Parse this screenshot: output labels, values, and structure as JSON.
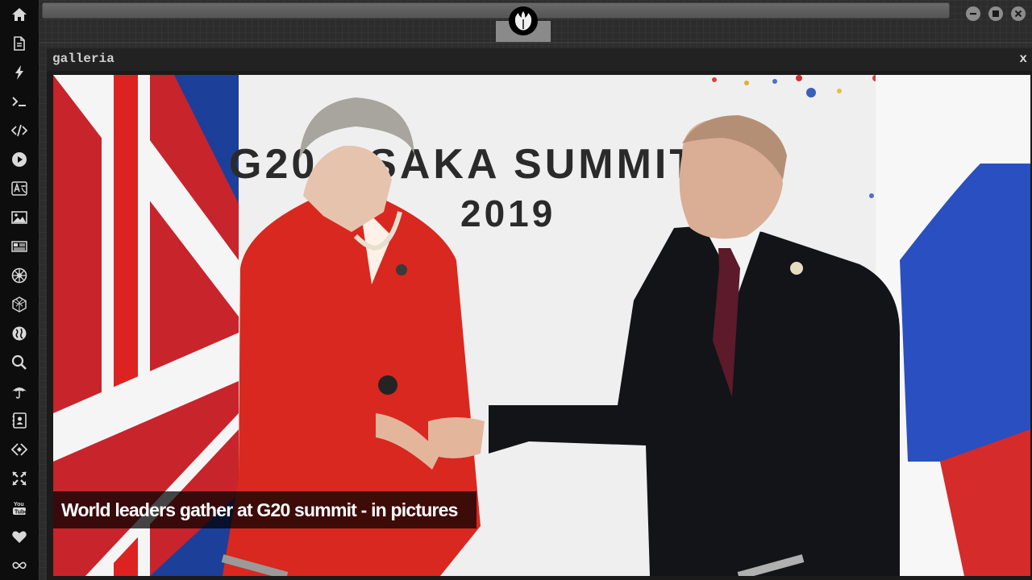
{
  "sidebar": {
    "items": [
      {
        "icon": "home-icon"
      },
      {
        "icon": "document-icon"
      },
      {
        "icon": "lightning-icon"
      },
      {
        "icon": "terminal-icon"
      },
      {
        "icon": "code-icon"
      },
      {
        "icon": "play-icon"
      },
      {
        "icon": "translate-icon"
      },
      {
        "icon": "image-icon"
      },
      {
        "icon": "newspaper-icon"
      },
      {
        "icon": "empire-icon"
      },
      {
        "icon": "cube-icon"
      },
      {
        "icon": "globe-icon"
      },
      {
        "icon": "search-icon"
      },
      {
        "icon": "umbrella-icon"
      },
      {
        "icon": "contacts-icon"
      },
      {
        "icon": "link-code-icon"
      },
      {
        "icon": "expand-icon"
      },
      {
        "icon": "youtube-icon"
      },
      {
        "icon": "heart-icon"
      },
      {
        "icon": "infinity-icon"
      }
    ]
  },
  "topbar": {
    "logo_icon": "rebel-alliance-icon",
    "buttons": [
      "minimize-icon",
      "maximize-icon",
      "close-icon"
    ]
  },
  "window": {
    "title": "galleria",
    "close_label": "x"
  },
  "gallery": {
    "banner_line1": "G20 OSAKA SUMMIT",
    "banner_line2": "2019",
    "caption": "World leaders gather at G20 summit - in pictures"
  },
  "colors": {
    "sidebar_bg": "#0d0d0d",
    "icon_color": "#d9d9d9",
    "window_bg": "#1b1b1b",
    "caption_bg": "#000000"
  }
}
